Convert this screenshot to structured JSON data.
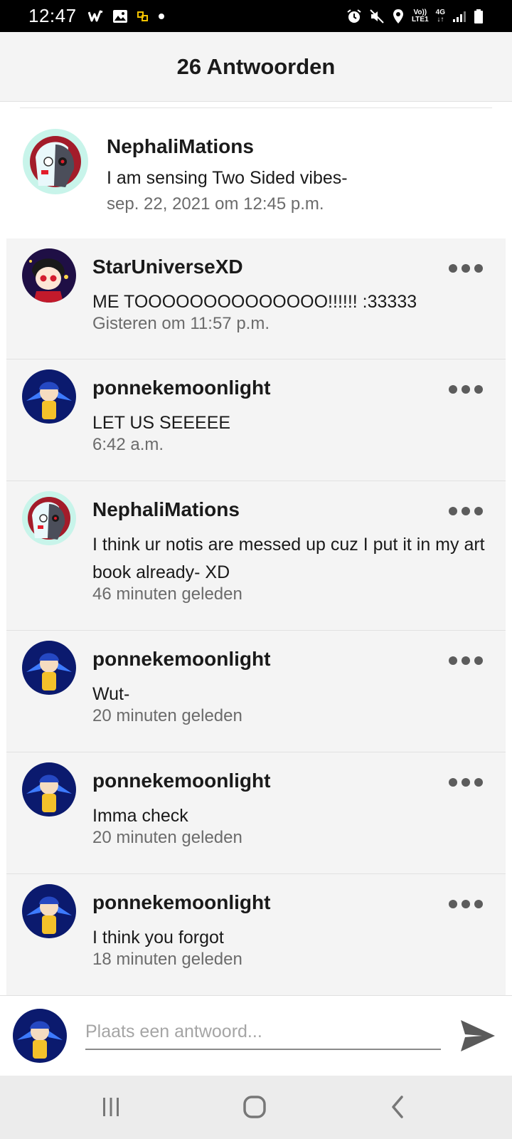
{
  "status_bar": {
    "time": "12:47",
    "network_top": "Vo))",
    "network_bottom": "LTE1",
    "signal_label": "4G"
  },
  "header": {
    "title": "26 Antwoorden"
  },
  "parent_comment": {
    "name": "NephaliMations",
    "text": "I am sensing Two Sided vibes-",
    "time": "sep. 22, 2021 om 12:45 p.m."
  },
  "replies": [
    {
      "name": "StarUniverseXD",
      "text": "ME TOOOOOOOOOOOOOO!!!!!! :33333",
      "time": "Gisteren om 11:57 p.m."
    },
    {
      "name": "ponnekemoonlight",
      "text": "LET US SEEEEE",
      "time": "6:42 a.m."
    },
    {
      "name": "NephaliMations",
      "text": "I think ur notis are messed up cuz I put it in my art book already- XD",
      "time": "46 minuten geleden"
    },
    {
      "name": "ponnekemoonlight",
      "text": "Wut-",
      "time": "20 minuten geleden"
    },
    {
      "name": "ponnekemoonlight",
      "text": "Imma check",
      "time": "20 minuten geleden"
    },
    {
      "name": "ponnekemoonlight",
      "text": "I think you forgot",
      "time": "18 minuten geleden"
    }
  ],
  "composer": {
    "placeholder": "Plaats een antwoord..."
  },
  "icons": {
    "more": "more-horizontal-icon",
    "send": "send-icon",
    "nav": [
      "recents-icon",
      "home-icon",
      "back-icon"
    ]
  },
  "colors": {
    "reply_background": "#f4f4f4",
    "status_bar": "#000000",
    "send_icon": "#5a5a5a"
  }
}
